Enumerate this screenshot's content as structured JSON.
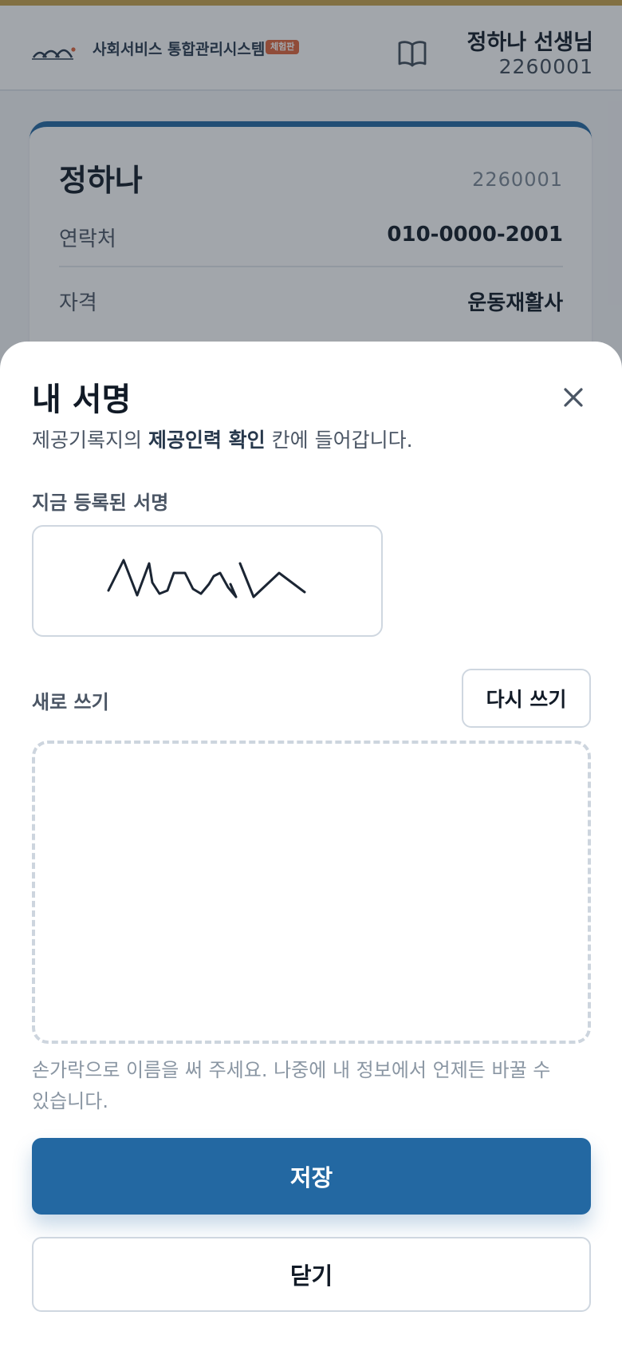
{
  "header": {
    "app_title": "사회서비스 통합관리시스템",
    "badge": "체험판",
    "user_name": "정하나 선생님",
    "user_id": "2260001"
  },
  "profile_card": {
    "name": "정하나",
    "id": "2260001",
    "rows": [
      {
        "label": "연락처",
        "value": "010-0000-2001"
      },
      {
        "label": "자격",
        "value": "운동재활사"
      }
    ]
  },
  "sheet": {
    "title": "내 서명",
    "desc_prefix": "제공기록지의 ",
    "desc_bold": "제공인력 확인",
    "desc_suffix": " 칸에 들어갑니다.",
    "current_label": "지금 등록된 서명",
    "new_label": "새로 쓰기",
    "rewrite_button": "다시 쓰기",
    "hint": "손가락으로 이름을 써 주세요. 나중에 내 정보에서 언제든 바꿀 수 있습니다.",
    "save_button": "저장",
    "close_button": "닫기"
  },
  "colors": {
    "primary": "#2368a2",
    "accent_bar": "#c8a24a",
    "badge": "#e0643c"
  },
  "icons": {
    "logo": "wave-logo-icon",
    "guide": "open-book-icon",
    "close": "close-icon"
  }
}
